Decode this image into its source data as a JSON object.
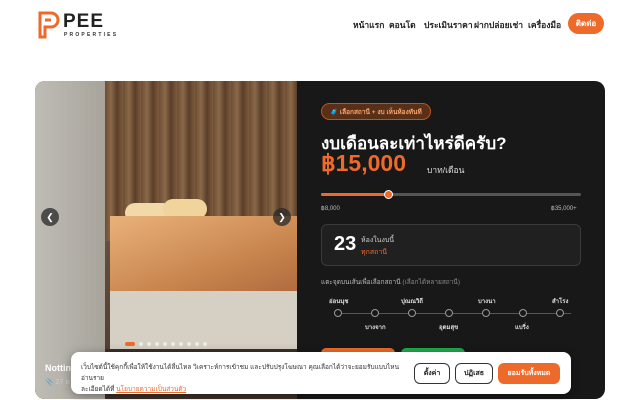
{
  "brand": {
    "name": "PEE",
    "sub": "PROPERTIES",
    "accent": "#ee6a2a"
  },
  "nav": {
    "items": [
      "หน้าแรก",
      "คอนโด",
      "ประเมินราคา",
      "ฝากปล่อยเช่า",
      "เครื่องมือ"
    ],
    "contact": "ติดต่อ"
  },
  "listing": {
    "name": "Nottin",
    "meta": "27 ต",
    "slide_count": 10,
    "active_slide": 1
  },
  "finder": {
    "badge": "🧳 เลือกสถานี + งบ เห็นห้องทันที",
    "question": "งบเดือนละเท่าไหร่ดีครับ?",
    "price": "฿15,000",
    "unit": "บาท/เดือน",
    "min_label": "฿8,000",
    "max_label": "฿35,000+",
    "budget_fraction": 0.26,
    "count": "23",
    "count_label": "ห้องในงบนี้",
    "count_sub": "ทุกสถานี",
    "hint": "แตะจุดบนเส้นเพื่อเลือกสถานี",
    "hint_sub": "(เลือกได้หลายสถานี)",
    "stations_top": [
      "อ่อนนุช",
      "ปุณณวิถี",
      "บางนา",
      "สำโรง"
    ],
    "stations_bottom": [
      "บางจาก",
      "อุดมสุข",
      "แบริ่ง"
    ]
  },
  "cookie": {
    "text": "เว็บไซต์นี้ใช้คุกกี้เพื่อให้ใช้งานได้ลื่นไหล วิเคราะห์การเข้าชม และปรับปรุงโฆษณา คุณเลือกได้ว่าจะยอมรับแบบไหน อ่านราย",
    "text2": "ละเอียดได้ที่",
    "link": "นโยบายความเป็นส่วนตัว",
    "settings": "ตั้งค่า",
    "reject": "ปฏิเสธ",
    "accept": "ยอมรับทั้งหมด"
  }
}
